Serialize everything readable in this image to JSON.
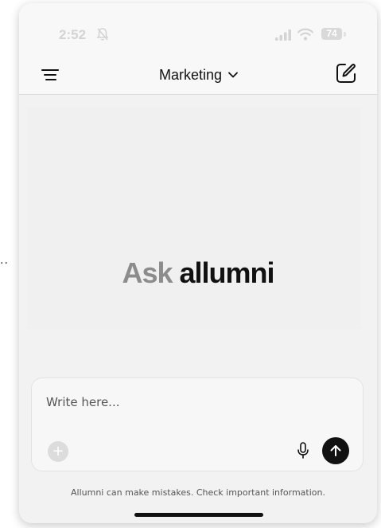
{
  "outside": {
    "dots": "··"
  },
  "status_bar": {
    "time": "2:52",
    "battery": "74",
    "icons": [
      "bell-slash-icon",
      "signal-icon",
      "wifi-icon",
      "battery-icon"
    ]
  },
  "nav": {
    "workspace": "Marketing",
    "icons": [
      "menu-icon",
      "chevron-down-icon",
      "compose-icon"
    ]
  },
  "hero": {
    "prefix": "Ask",
    "brand": "allumni"
  },
  "composer": {
    "placeholder": "Write here...",
    "value": "",
    "icons": [
      "add-icon",
      "microphone-icon",
      "send-arrow-icon"
    ]
  },
  "footer": {
    "disclaimer": "Allumni can make mistakes. Check important information."
  },
  "colors": {
    "background": "#f2f2f2",
    "text_primary": "#111111",
    "text_muted": "#8c8c8c",
    "send_button": "#111111"
  }
}
